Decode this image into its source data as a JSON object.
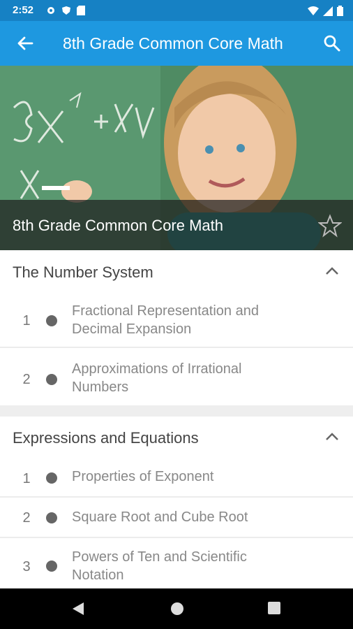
{
  "status": {
    "time": "2:52"
  },
  "appbar": {
    "title": "8th Grade Common Core Math"
  },
  "hero": {
    "caption": "8th Grade Common Core Math"
  },
  "sections": [
    {
      "title": "The Number System",
      "items": [
        {
          "num": "1",
          "line1": "Fractional Representation and",
          "line2": "Decimal Expansion"
        },
        {
          "num": "2",
          "line1": "Approximations of Irrational",
          "line2": "Numbers"
        }
      ]
    },
    {
      "title": "Expressions and Equations",
      "items": [
        {
          "num": "1",
          "line1": "Properties of Exponent"
        },
        {
          "num": "2",
          "line1": "Square Root and Cube Root"
        },
        {
          "num": "3",
          "line1": "Powers of Ten and Scientific",
          "line2": "Notation"
        }
      ]
    }
  ],
  "colors": {
    "appbar": "#1e98e0",
    "statusbar": "#1681c4"
  }
}
